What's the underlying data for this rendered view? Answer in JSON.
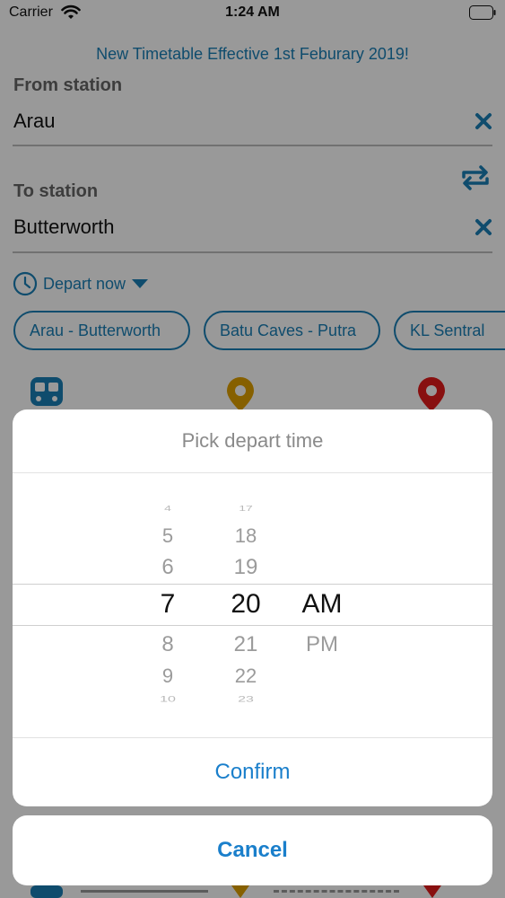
{
  "status_bar": {
    "carrier": "Carrier",
    "time": "1:24 AM"
  },
  "notice": "New Timetable Effective 1st Feburary 2019!",
  "from": {
    "label": "From station",
    "value": "Arau"
  },
  "to": {
    "label": "To station",
    "value": "Butterworth"
  },
  "depart": {
    "label": "Depart now"
  },
  "chips": [
    "Arau - Butterworth",
    "Batu Caves - Putra",
    "KL Sentral"
  ],
  "sheet": {
    "title": "Pick depart time",
    "hours": [
      "4",
      "5",
      "6",
      "7",
      "8",
      "9",
      "10"
    ],
    "minutes": [
      "17",
      "18",
      "19",
      "20",
      "21",
      "22",
      "23"
    ],
    "periods": [
      "AM",
      "PM"
    ],
    "selected": {
      "hour": "7",
      "minute": "20",
      "period": "AM"
    },
    "confirm_label": "Confirm",
    "cancel_label": "Cancel"
  },
  "icons": {
    "clear": "close-icon",
    "swap": "swap-icon",
    "clock": "clock-icon",
    "dropdown": "caret-down-icon",
    "train": "train-icon",
    "pin_origin": "pin-icon",
    "pin_destination": "pin-icon"
  },
  "colors": {
    "accent": "#1a7fb6",
    "pin_origin": "#e0a100",
    "pin_destination": "#e31b1b"
  }
}
